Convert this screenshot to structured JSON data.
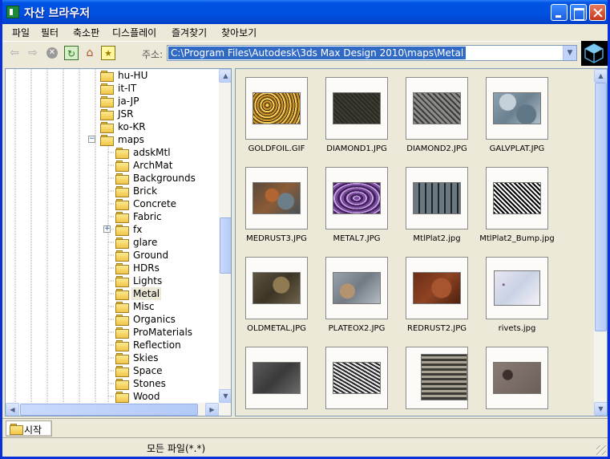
{
  "window": {
    "title": "자산 브라우저"
  },
  "menu": [
    "파일",
    "필터",
    "축소판",
    "디스플레이",
    "즐겨찾기",
    "찾아보기"
  ],
  "toolbar": {
    "address_label": "주소:",
    "address_value": "C:\\Program Files\\Autodesk\\3ds Max Design 2010\\maps\\Metal"
  },
  "tree": {
    "items": [
      {
        "label": "hu-HU",
        "level": 0,
        "toggle": ""
      },
      {
        "label": "it-IT",
        "level": 0,
        "toggle": ""
      },
      {
        "label": "ja-JP",
        "level": 0,
        "toggle": ""
      },
      {
        "label": "JSR",
        "level": 0,
        "toggle": ""
      },
      {
        "label": "ko-KR",
        "level": 0,
        "toggle": ""
      },
      {
        "label": "maps",
        "level": 0,
        "toggle": "−",
        "expanded": true
      },
      {
        "label": "adskMtl",
        "level": 1,
        "toggle": ""
      },
      {
        "label": "ArchMat",
        "level": 1,
        "toggle": ""
      },
      {
        "label": "Backgrounds",
        "level": 1,
        "toggle": ""
      },
      {
        "label": "Brick",
        "level": 1,
        "toggle": ""
      },
      {
        "label": "Concrete",
        "level": 1,
        "toggle": ""
      },
      {
        "label": "Fabric",
        "level": 1,
        "toggle": ""
      },
      {
        "label": "fx",
        "level": 1,
        "toggle": "+"
      },
      {
        "label": "glare",
        "level": 1,
        "toggle": ""
      },
      {
        "label": "Ground",
        "level": 1,
        "toggle": ""
      },
      {
        "label": "HDRs",
        "level": 1,
        "toggle": ""
      },
      {
        "label": "Lights",
        "level": 1,
        "toggle": ""
      },
      {
        "label": "Metal",
        "level": 1,
        "toggle": "",
        "selected": true
      },
      {
        "label": "Misc",
        "level": 1,
        "toggle": ""
      },
      {
        "label": "Organics",
        "level": 1,
        "toggle": ""
      },
      {
        "label": "ProMaterials",
        "level": 1,
        "toggle": ""
      },
      {
        "label": "Reflection",
        "level": 1,
        "toggle": ""
      },
      {
        "label": "Skies",
        "level": 1,
        "toggle": ""
      },
      {
        "label": "Space",
        "level": 1,
        "toggle": ""
      },
      {
        "label": "Stones",
        "level": 1,
        "toggle": ""
      },
      {
        "label": "Wood",
        "level": 1,
        "toggle": ""
      }
    ]
  },
  "thumbnails": [
    {
      "name": "GOLDFOIL.GIF",
      "texture": "goldfoil"
    },
    {
      "name": "DIAMOND1.JPG",
      "texture": "diamond1"
    },
    {
      "name": "DIAMOND2.JPG",
      "texture": "diamond2"
    },
    {
      "name": "GALVPLAT.JPG",
      "texture": "galvplat"
    },
    {
      "name": "MEDRUST3.JPG",
      "texture": "medrust3"
    },
    {
      "name": "METAL7.JPG",
      "texture": "metal7"
    },
    {
      "name": "MtlPlat2.jpg",
      "texture": "mtlplat2"
    },
    {
      "name": "MtlPlat2_Bump.jpg",
      "texture": "mtlplat2bump"
    },
    {
      "name": "OLDMETAL.JPG",
      "texture": "oldmetal"
    },
    {
      "name": "PLATEOX2.JPG",
      "texture": "plateox2"
    },
    {
      "name": "REDRUST2.JPG",
      "texture": "redrust2"
    },
    {
      "name": "rivets.jpg",
      "texture": "rivets"
    },
    {
      "name": "",
      "texture": "row4a"
    },
    {
      "name": "",
      "texture": "row4b"
    },
    {
      "name": "",
      "texture": "row4c"
    },
    {
      "name": "",
      "texture": "row4d"
    }
  ],
  "bottom": {
    "start_label": "시작"
  },
  "status": {
    "filter": "모든 파일(*.*)"
  }
}
